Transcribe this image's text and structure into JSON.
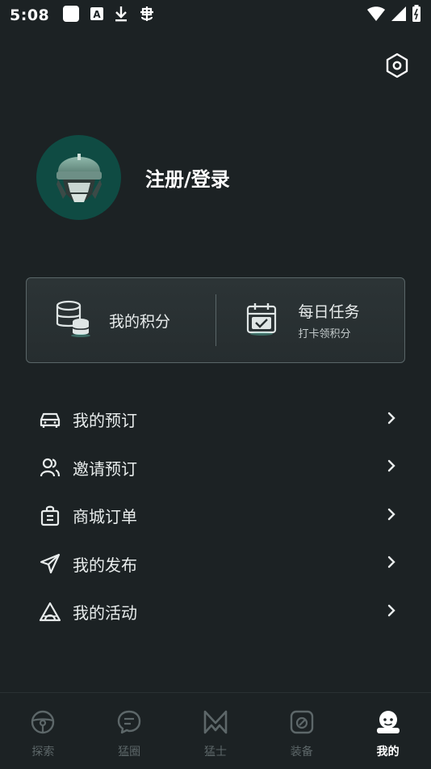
{
  "status_bar": {
    "time": "5:08"
  },
  "profile": {
    "login_label": "注册/登录"
  },
  "card": {
    "points_label": "我的积分",
    "tasks_title": "每日任务",
    "tasks_subtitle": "打卡领积分"
  },
  "menu": [
    {
      "label": "我的预订",
      "icon": "car-icon"
    },
    {
      "label": "邀请预订",
      "icon": "users-icon"
    },
    {
      "label": "商城订单",
      "icon": "shopping-bag-icon"
    },
    {
      "label": "我的发布",
      "icon": "send-icon"
    },
    {
      "label": "我的活动",
      "icon": "tent-icon"
    }
  ],
  "tabs": [
    {
      "label": "探索",
      "icon": "steering-wheel-icon",
      "active": false
    },
    {
      "label": "猛圈",
      "icon": "chat-bubble-icon",
      "active": false
    },
    {
      "label": "猛士",
      "icon": "m-logo-icon",
      "active": false
    },
    {
      "label": "装备",
      "icon": "equipment-icon",
      "active": false
    },
    {
      "label": "我的",
      "icon": "user-face-icon",
      "active": true
    }
  ],
  "colors": {
    "background": "#1c2224",
    "avatar_bg": "#0f4b43",
    "accent": "#5fd6bf",
    "inactive_tab": "#5d6769"
  }
}
